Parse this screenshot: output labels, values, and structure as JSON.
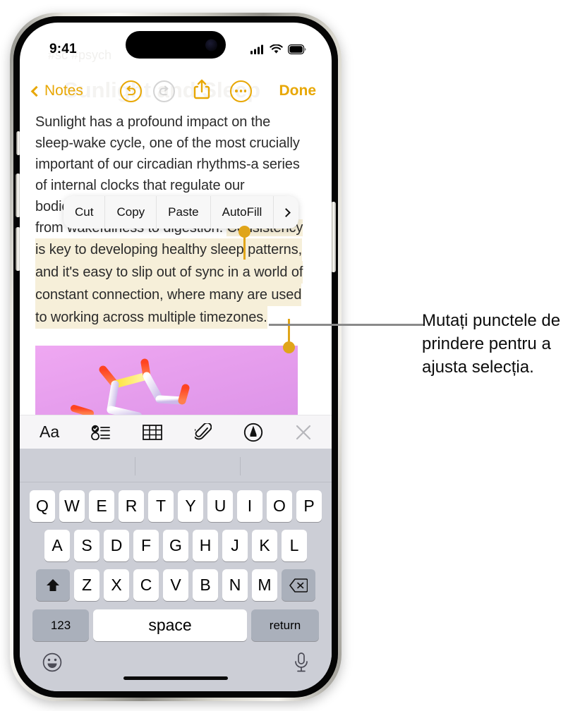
{
  "status_bar": {
    "time": "9:41",
    "cellular_icon": "cellular-bars-icon",
    "wifi_icon": "wifi-icon",
    "battery_icon": "battery-full-icon"
  },
  "ghost": {
    "tags": "#sc #psych",
    "title": "Sunlight and Sleep"
  },
  "nav_bar": {
    "back_label": "Notes",
    "undo_icon": "undo-icon",
    "redo_icon": "redo-icon",
    "share_icon": "share-icon",
    "more_icon": "more-ellipsis-icon",
    "done_label": "Done"
  },
  "note": {
    "lines": [
      "Sunlight has a profound impact on the",
      "sleep-wake cycle, one of the most crucially",
      "important of our circadian rhythms-a series",
      "of internal clocks that regulate our",
      "bodies' functions to optimize everything"
    ],
    "selected_first_line_prefix": "from wakefulness to digestion. ",
    "selected_first_line_highlight": "Consistency",
    "selected_lines": [
      "is key to developing healthy sleep patterns,",
      "and it's easy to slip out of sync in a world of",
      "constant connection, where many are used",
      "to working across multiple timezones."
    ],
    "highlight_color": "#f6efd9",
    "handle_color": "#e0a51a",
    "image_alt": "molecule-illustration"
  },
  "edit_menu": {
    "items": [
      {
        "label": "Cut",
        "name": "cut"
      },
      {
        "label": "Copy",
        "name": "copy"
      },
      {
        "label": "Paste",
        "name": "paste"
      },
      {
        "label": "AutoFill",
        "name": "autofill"
      }
    ],
    "more_icon": "chevron-right-icon"
  },
  "format_bar": {
    "items": [
      {
        "label": "Aa",
        "name": "text-format-icon"
      },
      {
        "label": "",
        "name": "checklist-icon"
      },
      {
        "label": "",
        "name": "table-icon"
      },
      {
        "label": "",
        "name": "attachment-paperclip-icon"
      },
      {
        "label": "",
        "name": "markup-pen-icon"
      },
      {
        "label": "",
        "name": "close-icon"
      }
    ]
  },
  "keyboard": {
    "row1": [
      "Q",
      "W",
      "E",
      "R",
      "T",
      "Y",
      "U",
      "I",
      "O",
      "P"
    ],
    "row2": [
      "A",
      "S",
      "D",
      "F",
      "G",
      "H",
      "J",
      "K",
      "L"
    ],
    "row3": [
      "Z",
      "X",
      "C",
      "V",
      "B",
      "N",
      "M"
    ],
    "shift_icon": "shift-up-arrow-icon",
    "backspace_icon": "backspace-delete-icon",
    "numbers_label": "123",
    "space_label": "space",
    "return_label": "return",
    "emoji_icon": "emoji-smiley-icon",
    "dictation_icon": "microphone-icon"
  },
  "callout": {
    "text": "Mutați punctele de prindere pentru a ajusta selecția.",
    "line_color": "#8a8a8a"
  },
  "colors": {
    "accent": "#e8a704",
    "keyboard_bg": "#ccced6",
    "key_bg": "#ffffff",
    "modifier_key_bg": "#aab0bb"
  }
}
